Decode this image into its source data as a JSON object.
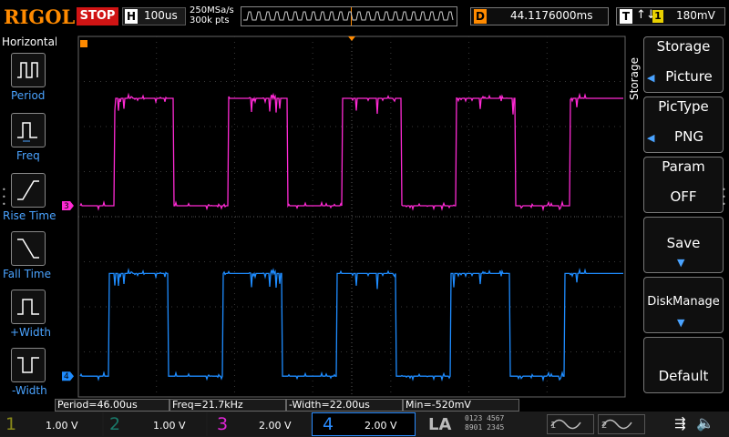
{
  "brand": "RIGOL",
  "run_state": "STOP",
  "horizontal": {
    "label": "H",
    "timebase": "100us",
    "sample_rate": "250MSa/s",
    "memory_depth": "300k pts"
  },
  "delay": {
    "label": "D",
    "value": "44.1176000ms"
  },
  "trigger": {
    "label": "T",
    "edge": "↑↓",
    "source": "1",
    "level": "180mV"
  },
  "left_menu": {
    "title": "Horizontal",
    "items": [
      {
        "label": "Period",
        "icon": "period-icon"
      },
      {
        "label": "Freq",
        "icon": "freq-icon"
      },
      {
        "label": "Rise Time",
        "icon": "rise-time-icon"
      },
      {
        "label": "Fall Time",
        "icon": "fall-time-icon"
      },
      {
        "label": "+Width",
        "icon": "pos-width-icon"
      },
      {
        "label": "-Width",
        "icon": "neg-width-icon"
      }
    ]
  },
  "right_menu": {
    "side_label": "Storage",
    "items": [
      {
        "title": "Storage",
        "value": "Picture"
      },
      {
        "title": "PicType",
        "value": "PNG"
      },
      {
        "title": "Param",
        "value": "OFF"
      },
      {
        "title": "Save",
        "value": ""
      },
      {
        "title": "DiskManage",
        "value": ""
      },
      {
        "title": "Default",
        "value": ""
      }
    ]
  },
  "measurements": [
    "Period=46.00us",
    "Freq=21.7kHz",
    "-Width=22.00us",
    "Min=-520mV"
  ],
  "channels": [
    {
      "num": "1",
      "scale": "1.00 V",
      "color": "#8a8a1a"
    },
    {
      "num": "2",
      "scale": "1.00 V",
      "color": "#1a7a6a"
    },
    {
      "num": "3",
      "scale": "2.00 V",
      "color": "#e026d6"
    },
    {
      "num": "4",
      "scale": "2.00 V",
      "color": "#2a8cff"
    }
  ],
  "waveforms": {
    "ch3": {
      "marker": "3",
      "color": "#ff2ad4",
      "low_level_fraction": 0.47,
      "high_level_fraction": 0.175
    },
    "ch4": {
      "marker": "4",
      "color": "#1e8cff",
      "low_level_fraction": 0.938,
      "high_level_fraction": 0.656
    },
    "period_divisions": 1.46,
    "first_rise_divisions": 0.46
  },
  "la": "LA",
  "digital_channels": {
    "row1": "0123 4567",
    "row2": "8901 2345"
  },
  "gen": [
    "1",
    "2"
  ]
}
